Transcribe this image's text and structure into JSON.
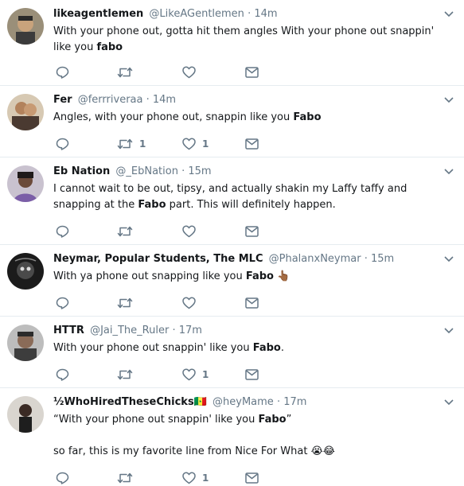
{
  "tweets": [
    {
      "name": "likeagentlemen",
      "handle": "@LikeAGentlemen",
      "dot": "·",
      "time": "14m",
      "text_a": "With your phone out, gotta hit them angles With your phone out snappin' like you ",
      "bold": "fabo",
      "text_b": "",
      "reply_count": "",
      "retweet_count": "",
      "like_count": ""
    },
    {
      "name": "Fer",
      "handle": "@ferrriveraa",
      "dot": "·",
      "time": "14m",
      "text_a": "Angles, with your phone out, snappin like you ",
      "bold": "Fabo",
      "text_b": "",
      "reply_count": "",
      "retweet_count": "1",
      "like_count": "1"
    },
    {
      "name": "Eb Nation",
      "handle": "@_EbNation",
      "dot": "·",
      "time": "15m",
      "text_a": "I cannot wait to be out, tipsy, and actually shakin my Laffy taffy and snapping at the ",
      "bold": "Fabo",
      "text_b": " part. This will definitely happen.",
      "reply_count": "",
      "retweet_count": "",
      "like_count": ""
    },
    {
      "name": "Neymar, Popular Students, The MLC",
      "handle": "@PhalanxNeymar",
      "dot": "·",
      "time": "15m",
      "text_a": "With ya phone out snapping like you ",
      "bold": "Fabo",
      "text_b": "",
      "emoji": "👆🏾",
      "reply_count": "",
      "retweet_count": "",
      "like_count": ""
    },
    {
      "name": "HTTR",
      "handle": "@Jai_The_Ruler",
      "dot": "·",
      "time": "17m",
      "text_a": "With your phone out snappin' like you ",
      "bold": "Fabo",
      "text_b": ".",
      "reply_count": "",
      "retweet_count": "",
      "like_count": "1"
    },
    {
      "name": "½WhoHiredTheseChicks",
      "name_flag": "🇸🇳",
      "handle": "@heyMame",
      "dot": "·",
      "time": "17m",
      "text_a": "“With your phone out snappin' like you ",
      "bold": "Fabo",
      "text_b": "”",
      "text_line2": "so far, this is my favorite line from Nice For What",
      "emoji_line2": "😭😂",
      "reply_count": "",
      "retweet_count": "",
      "like_count": "1"
    }
  ],
  "icons": {
    "reply": "reply-icon",
    "retweet": "retweet-icon",
    "like": "heart-icon",
    "dm": "envelope-icon",
    "more": "chevron-down-icon"
  },
  "colors": {
    "name": "#14171a",
    "meta": "#657786",
    "icon": "#657786",
    "divider": "#e6ecf0"
  }
}
